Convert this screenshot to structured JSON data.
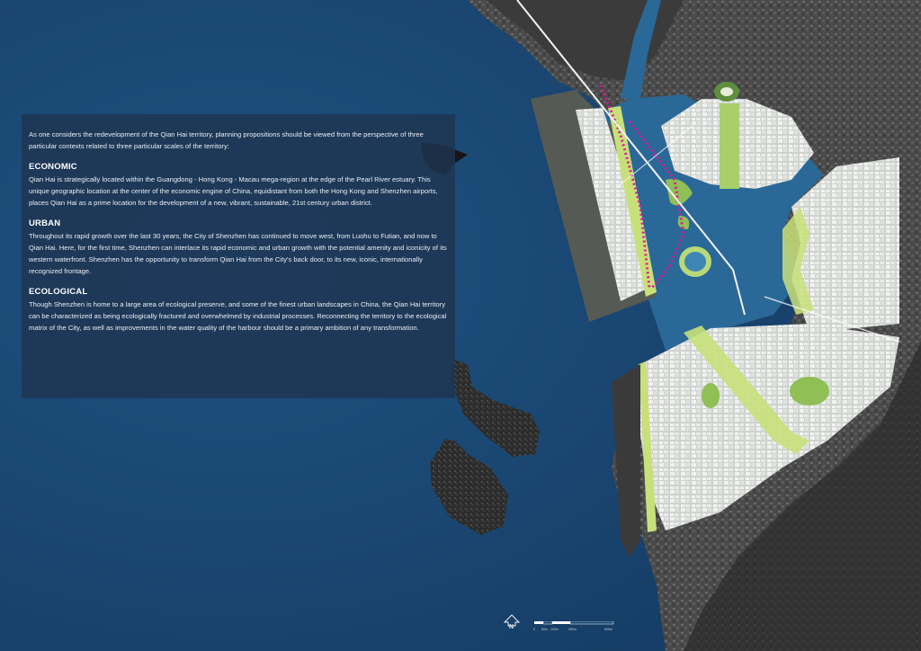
{
  "intro": "As one considers the redevelopment of the Qian Hai territory, planning propositions should be viewed from the perspective of three particular contexts related to three particular scales of the territory:",
  "sections": [
    {
      "heading": "ECONOMIC",
      "body": "Qian Hai is strategically located within the Guangdong - Hong Kong - Macau mega-region at the edge of the Pearl River estuary.  This unique geographic location at the center of the economic engine of China, equidistant from both the Hong Kong and Shenzhen airports, places Qian Hai as a prime location for the development of a new, vibrant, sustainable, 21st century urban district."
    },
    {
      "heading": "URBAN",
      "body": "Throughout its rapid growth over the last 30 years, the City of Shenzhen has continued to move west, from Luohu to Futian, and now to Qian Hai.  Here, for the first time, Shenzhen can interlace its rapid economic and urban growth with the potential amenity and iconicity of its western waterfront.  Shenzhen has the opportunity to transform Qian Hai from the City's back door, to its new, iconic, internationally recognized frontage."
    },
    {
      "heading": "ECOLOGICAL",
      "body": "Though Shenzhen is home to a large area of ecological preserve, and some of the finest urban landscapes in China, the Qian Hai territory can be characterized as being ecologically fractured and overwhelmed by industrial processes.  Reconnecting the territory to the ecological matrix of the City, as well as improvements in the water quality of the harbour should be a primary ambition of any transformation."
    }
  ],
  "north_label": "N",
  "scale_labels": [
    "0",
    "50m",
    "100m",
    "200m",
    "500m"
  ],
  "colors": {
    "sea": "#1c4a74",
    "land": "#3a3a3a",
    "green": "#c8e07a",
    "bay_water": "#2d6a96",
    "magenta": "#e0169a",
    "panel": "#1e3450"
  }
}
